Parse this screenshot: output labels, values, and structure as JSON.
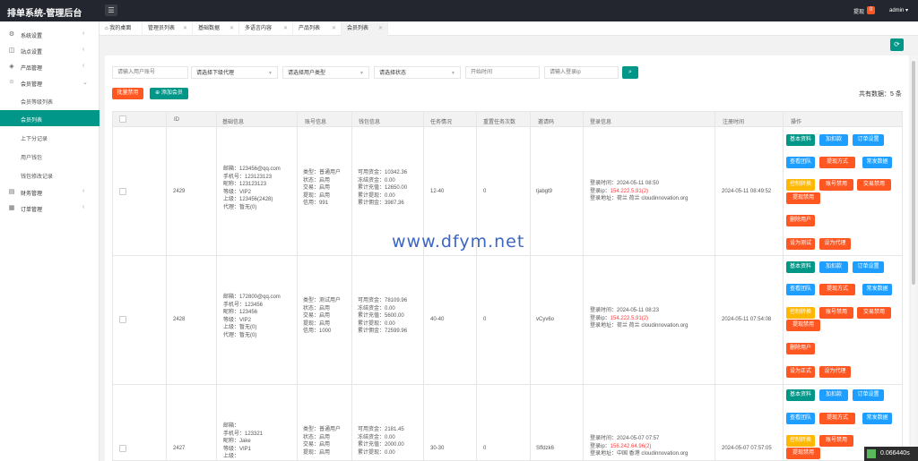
{
  "header": {
    "brand": "排单系统-管理后台",
    "tip_label": "提现",
    "tip_count": "0",
    "user": "admin"
  },
  "sidebar": {
    "items": [
      {
        "label": "系统设置"
      },
      {
        "label": "站点设置"
      },
      {
        "label": "产品管理"
      },
      {
        "label": "会员管理"
      },
      {
        "label": "会员等级列表"
      },
      {
        "label": "会员列表"
      },
      {
        "label": "上下分记录"
      },
      {
        "label": "用户钱包"
      },
      {
        "label": "钱包修改记录"
      },
      {
        "label": "财务管理"
      },
      {
        "label": "订单管理"
      }
    ]
  },
  "tabs": [
    {
      "label": "我的桌面"
    },
    {
      "label": "管理员列表"
    },
    {
      "label": "基础数据"
    },
    {
      "label": "多语言内容"
    },
    {
      "label": "产品列表"
    },
    {
      "label": "会员列表"
    }
  ],
  "filters": {
    "account_placeholder": "请输入用户账号",
    "agent_select": "请选择下级代理",
    "type_select": "请选择用户类型",
    "status_select": "请选择状态",
    "start_time_placeholder": "开始时间",
    "ip_placeholder": "请输入登录ip"
  },
  "toolbar": {
    "batch_disable": "批量禁用",
    "add_member": "添加会员",
    "total": "共有数据：5 条"
  },
  "table": {
    "headers": [
      "ID",
      "基础信息",
      "账号信息",
      "钱包信息",
      "任务情况",
      "重置任务次数",
      "邀请码",
      "登录信息",
      "注册时间",
      "操作"
    ],
    "rows": [
      {
        "id": "2429",
        "basic": [
          "邮箱：123456@qq.com",
          "手机号：123123123",
          "昵称：123123123",
          "等级：VIP2",
          "上级：123456(2428)",
          "代理：暂无(0)"
        ],
        "account": [
          "类型：普通用户",
          "状态：启用",
          "交易：启用",
          "提现：启用",
          "信用：991"
        ],
        "wallet": [
          "可用资金：10342.36",
          "冻结资金：0.00",
          "累计充值：12650.00",
          "累计提现：0.00",
          "累计佣金：3987.36"
        ],
        "task": "12-40",
        "reset": "0",
        "invite": "tjabgt9",
        "login_time": "登录时间：2024-05-11 08:50",
        "login_ip_label": "登录ip：",
        "login_ip": "154.222.5.91(2)",
        "login_addr": "登录地址：荷兰 荷兰 cloudinnovation.org",
        "reg_time": "2024-05-11 08:49:52",
        "test_btn": "设为测试"
      },
      {
        "id": "2428",
        "basic": [
          "邮箱：172800@qq.com",
          "手机号：123456",
          "昵称：123456",
          "等级：VIP2",
          "上级：暂无(0)",
          "代理：暂无(0)"
        ],
        "account": [
          "类型：测试用户",
          "状态：启用",
          "交易：启用",
          "提现：启用",
          "信用：1000"
        ],
        "wallet": [
          "可用资金：78109.96",
          "冻结资金：0.00",
          "累计充值：5600.00",
          "累计提现：0.00",
          "累计佣金：72599.96"
        ],
        "task": "40-40",
        "reset": "0",
        "invite": "vCyv6o",
        "login_time": "登录时间：2024-05-11 08:23",
        "login_ip_label": "登录ip：",
        "login_ip": "154.222.5.91(2)",
        "login_addr": "登录地址：荷兰 荷兰 cloudinnovation.org",
        "reg_time": "2024-05-11 07:54:08",
        "test_btn": "设为正式"
      },
      {
        "id": "2427",
        "basic": [
          "邮箱：",
          "手机号：123321",
          "昵称：Jake",
          "等级：VIP1",
          "上级："
        ],
        "account": [
          "类型：普通用户",
          "状态：启用",
          "交易：启用",
          "提现：启用"
        ],
        "wallet": [
          "可用资金：2181.45",
          "冻结资金：0.00",
          "累计充值：2000.00",
          "累计提现：0.00"
        ],
        "task": "30-30",
        "reset": "0",
        "invite": "Sffdzk6",
        "login_time": "登录时间：2024-05-07 07:57",
        "login_ip_label": "登录ip：",
        "login_ip": "156.242.64.96(2)",
        "login_addr": "登录地址：中国 香港 cloudinnovation.org",
        "reg_time": "2024-05-07 07:57:05"
      }
    ],
    "actions": {
      "basic": "基本资料",
      "deduct": "加扣款",
      "orders": "订单设置",
      "team": "查看团队",
      "withdraw_method": "提现方式",
      "bank": "常发数据",
      "trade_ctrl": "控制转换",
      "account_disable": "账号禁用",
      "trade_disable": "交易禁用",
      "withdraw_disable": "提现禁用",
      "delete": "删除用户",
      "set_agent": "设为代理"
    }
  },
  "watermark": "www.dfym.net",
  "timer": "0.066440s",
  "colors": {
    "accent": "#009688",
    "danger": "#ff5722",
    "info": "#1e9fff",
    "warn": "#ffb800"
  }
}
